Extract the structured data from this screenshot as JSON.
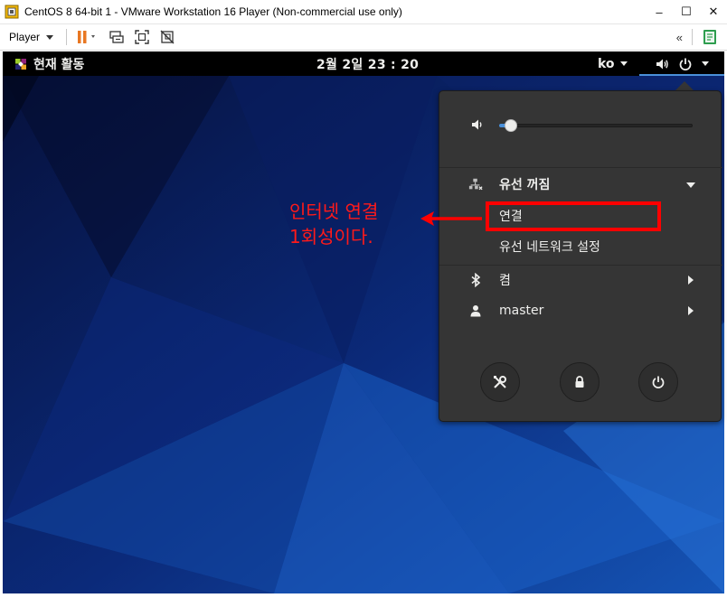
{
  "window": {
    "title": "CentOS 8 64-bit 1 - VMware Workstation 16 Player (Non-commercial use only)",
    "controls": {
      "minimize": "–",
      "maximize": "☐",
      "close": "✕"
    }
  },
  "toolbar": {
    "player_label": "Player",
    "collapse_symbol": "«",
    "icons": [
      "pause-icon",
      "send-ctrl-alt-del-icon",
      "fit-guest-icon",
      "unity-icon",
      "library-icon"
    ],
    "pause_color": "#e87722"
  },
  "gnome_bar": {
    "activities": "현재 활동",
    "clock": "2월 2일  23 : 20",
    "input_source": "ko"
  },
  "system_menu": {
    "volume_level": 0.06,
    "network": {
      "title": "유선 꺼짐",
      "items": [
        {
          "label": "연결"
        },
        {
          "label": "유선 네트워크 설정"
        }
      ]
    },
    "bluetooth": {
      "label": "켬"
    },
    "user": {
      "label": "master"
    },
    "actions": [
      "settings-icon",
      "lock-icon",
      "power-icon"
    ],
    "accent_color": "#4a90d9"
  },
  "annotation": {
    "text": "인터넷 연결\n1회성이다.",
    "color": "#ff0000"
  }
}
